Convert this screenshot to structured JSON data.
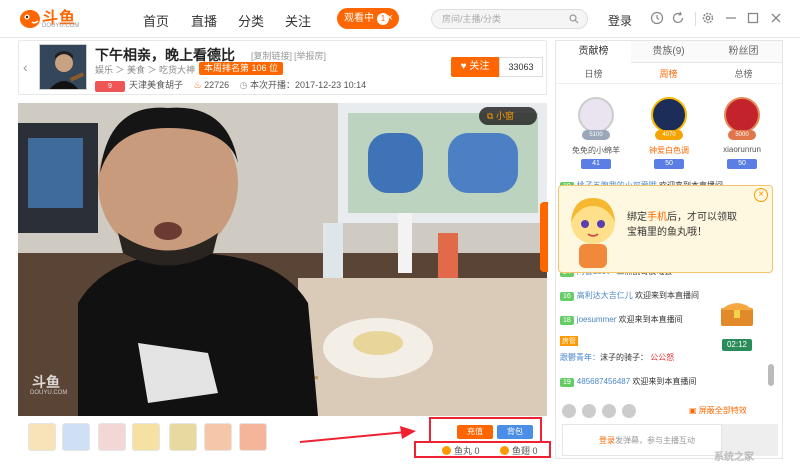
{
  "titlebar": {
    "logo_text": "斗鱼",
    "logo_sub": "DOUYU.COM",
    "nav": [
      "首页",
      "直播",
      "分类",
      "关注"
    ],
    "watching_label": "观看中",
    "watching_count": "1",
    "watching_close": "×",
    "search_placeholder": "房间/主播/分类",
    "login_label": "登录"
  },
  "room": {
    "title": "下午相亲，晚上看德比",
    "copy_link": "[复制链接]",
    "report": "[举报房]",
    "category_line": "娱乐 ＞ 美食 ＞ 吃货大神",
    "rank_label": "本周排名第 106 位",
    "level": "9",
    "streamer": "天津美食胡子",
    "hot": "22726",
    "start_time": "本次开播：2017-12-23 10:14",
    "follow_label": "关注",
    "follow_count": "33063"
  },
  "video": {
    "small_window_label": "小窗",
    "watermark": "斗鱼",
    "watermark_sub": "DOUYU.COM"
  },
  "gifts_bar": {
    "recharge_label": "充值",
    "backpack_label": "背包",
    "fishball_label": "鱼丸 0",
    "fishfin_label": "鱼翅 0"
  },
  "right_panel": {
    "tabs": [
      "贡献榜",
      "贵族(9)",
      "粉丝团"
    ],
    "subtabs": [
      "日榜",
      "周榜",
      "总榜"
    ],
    "podium": [
      {
        "amount": "5100",
        "name": "免免的小绵羊",
        "level": "41"
      },
      {
        "amount": "4070",
        "name": "钟爱白色调",
        "level": "50"
      },
      {
        "amount": "5000",
        "name": "xiaorunrun",
        "level": "50"
      }
    ],
    "chat": [
      {
        "level": "19",
        "user": "桃子五腹我的小可爱哦",
        "text": "欢迎来到本直播间"
      },
      {
        "level": "24",
        "user": "阿盲159：",
        "text": "三点凯哥晨曦会"
      },
      {
        "level": "16",
        "user": "高利达大吉仁儿",
        "text": "欢迎来到本直播间"
      },
      {
        "level": "18",
        "user": "joesummer",
        "text": "欢迎来到本直播间"
      },
      {
        "tag": "房管",
        "user": "跟鬱青年：",
        "text": "沫子的骑子：",
        "suffix": "公公怒"
      },
      {
        "level": "19",
        "user": "485687456487",
        "text": "欢迎来到本直播间"
      }
    ],
    "promo_text": "绑定手机后，才可以领取宝箱里的鱼丸哦！",
    "promo_highlight": "手机",
    "timer": "02:12",
    "block_effects": "屏蔽全部特效",
    "chat_login": "登录",
    "chat_placeholder": "发弹幕，参与主播互动"
  },
  "corner_watermark": "系统之家"
}
